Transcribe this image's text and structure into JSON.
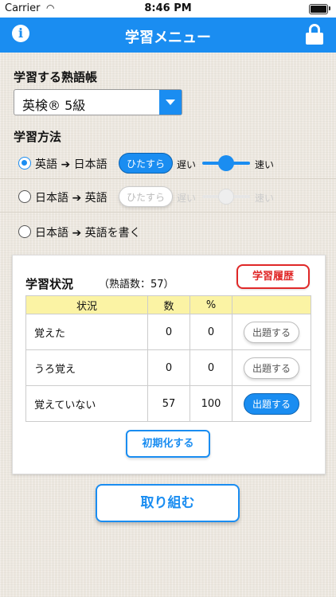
{
  "status_bar": {
    "carrier": "Carrier",
    "time": "8:46 PM"
  },
  "nav": {
    "title": "学習メニュー",
    "info_icon": "i",
    "left_icon": "info-icon",
    "right_icon": "lock-icon"
  },
  "book_section": {
    "label": "学習する熟語帳",
    "selected": "英検® 5級"
  },
  "method_section": {
    "label": "学習方法",
    "options": [
      {
        "text": "英語 ➔ 日本語",
        "selected": true,
        "mode": "ひたすら",
        "slow": "遅い",
        "fast": "速い",
        "enabled": true,
        "speed": 0.5
      },
      {
        "text": "日本語 ➔ 英語",
        "selected": false,
        "mode": "ひたすら",
        "slow": "遅い",
        "fast": "速い",
        "enabled": false,
        "speed": 0.5
      },
      {
        "text": "日本語 ➔ 英語を書く",
        "selected": false
      }
    ]
  },
  "status_card": {
    "title": "学習状況",
    "count": "（熟語数：57）",
    "history_button": "学習履歴",
    "columns": [
      "状況",
      "数",
      "%",
      ""
    ],
    "rows": [
      {
        "name": "覚えた",
        "count": "0",
        "percent": "0",
        "button": "出題する",
        "active": false
      },
      {
        "name": "うろ覚え",
        "count": "0",
        "percent": "0",
        "button": "出題する",
        "active": false
      },
      {
        "name": "覚えていない",
        "count": "57",
        "percent": "100",
        "button": "出題する",
        "active": true
      }
    ],
    "reset_button": "初期化する"
  },
  "start_button": "取り組む",
  "colors": {
    "accent": "#1a8df1",
    "history": "#e02828",
    "header_row": "#fbf3a4"
  }
}
